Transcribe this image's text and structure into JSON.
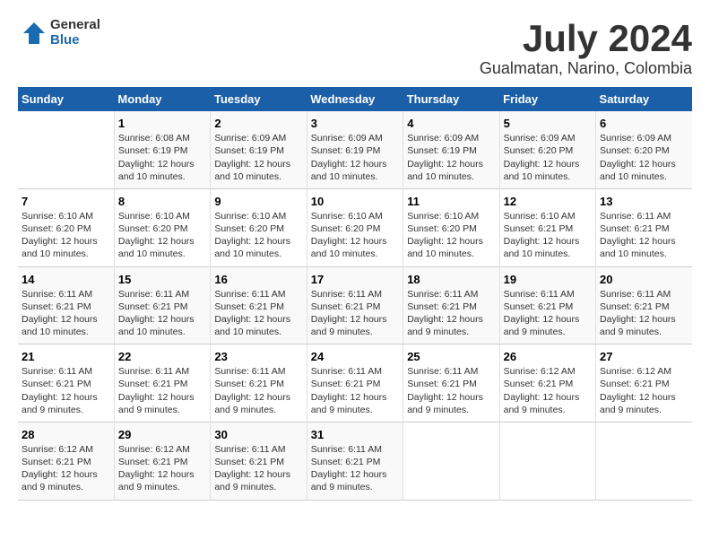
{
  "logo": {
    "text_general": "General",
    "text_blue": "Blue"
  },
  "header": {
    "title": "July 2024",
    "subtitle": "Gualmatan, Narino, Colombia"
  },
  "calendar": {
    "days_of_week": [
      "Sunday",
      "Monday",
      "Tuesday",
      "Wednesday",
      "Thursday",
      "Friday",
      "Saturday"
    ],
    "weeks": [
      [
        {
          "day": "",
          "info": ""
        },
        {
          "day": "1",
          "info": "Sunrise: 6:08 AM\nSunset: 6:19 PM\nDaylight: 12 hours and 10 minutes."
        },
        {
          "day": "2",
          "info": "Sunrise: 6:09 AM\nSunset: 6:19 PM\nDaylight: 12 hours and 10 minutes."
        },
        {
          "day": "3",
          "info": "Sunrise: 6:09 AM\nSunset: 6:19 PM\nDaylight: 12 hours and 10 minutes."
        },
        {
          "day": "4",
          "info": "Sunrise: 6:09 AM\nSunset: 6:19 PM\nDaylight: 12 hours and 10 minutes."
        },
        {
          "day": "5",
          "info": "Sunrise: 6:09 AM\nSunset: 6:20 PM\nDaylight: 12 hours and 10 minutes."
        },
        {
          "day": "6",
          "info": "Sunrise: 6:09 AM\nSunset: 6:20 PM\nDaylight: 12 hours and 10 minutes."
        }
      ],
      [
        {
          "day": "7",
          "info": "Sunrise: 6:10 AM\nSunset: 6:20 PM\nDaylight: 12 hours and 10 minutes."
        },
        {
          "day": "8",
          "info": "Sunrise: 6:10 AM\nSunset: 6:20 PM\nDaylight: 12 hours and 10 minutes."
        },
        {
          "day": "9",
          "info": "Sunrise: 6:10 AM\nSunset: 6:20 PM\nDaylight: 12 hours and 10 minutes."
        },
        {
          "day": "10",
          "info": "Sunrise: 6:10 AM\nSunset: 6:20 PM\nDaylight: 12 hours and 10 minutes."
        },
        {
          "day": "11",
          "info": "Sunrise: 6:10 AM\nSunset: 6:20 PM\nDaylight: 12 hours and 10 minutes."
        },
        {
          "day": "12",
          "info": "Sunrise: 6:10 AM\nSunset: 6:21 PM\nDaylight: 12 hours and 10 minutes."
        },
        {
          "day": "13",
          "info": "Sunrise: 6:11 AM\nSunset: 6:21 PM\nDaylight: 12 hours and 10 minutes."
        }
      ],
      [
        {
          "day": "14",
          "info": "Sunrise: 6:11 AM\nSunset: 6:21 PM\nDaylight: 12 hours and 10 minutes."
        },
        {
          "day": "15",
          "info": "Sunrise: 6:11 AM\nSunset: 6:21 PM\nDaylight: 12 hours and 10 minutes."
        },
        {
          "day": "16",
          "info": "Sunrise: 6:11 AM\nSunset: 6:21 PM\nDaylight: 12 hours and 10 minutes."
        },
        {
          "day": "17",
          "info": "Sunrise: 6:11 AM\nSunset: 6:21 PM\nDaylight: 12 hours and 9 minutes."
        },
        {
          "day": "18",
          "info": "Sunrise: 6:11 AM\nSunset: 6:21 PM\nDaylight: 12 hours and 9 minutes."
        },
        {
          "day": "19",
          "info": "Sunrise: 6:11 AM\nSunset: 6:21 PM\nDaylight: 12 hours and 9 minutes."
        },
        {
          "day": "20",
          "info": "Sunrise: 6:11 AM\nSunset: 6:21 PM\nDaylight: 12 hours and 9 minutes."
        }
      ],
      [
        {
          "day": "21",
          "info": "Sunrise: 6:11 AM\nSunset: 6:21 PM\nDaylight: 12 hours and 9 minutes."
        },
        {
          "day": "22",
          "info": "Sunrise: 6:11 AM\nSunset: 6:21 PM\nDaylight: 12 hours and 9 minutes."
        },
        {
          "day": "23",
          "info": "Sunrise: 6:11 AM\nSunset: 6:21 PM\nDaylight: 12 hours and 9 minutes."
        },
        {
          "day": "24",
          "info": "Sunrise: 6:11 AM\nSunset: 6:21 PM\nDaylight: 12 hours and 9 minutes."
        },
        {
          "day": "25",
          "info": "Sunrise: 6:11 AM\nSunset: 6:21 PM\nDaylight: 12 hours and 9 minutes."
        },
        {
          "day": "26",
          "info": "Sunrise: 6:12 AM\nSunset: 6:21 PM\nDaylight: 12 hours and 9 minutes."
        },
        {
          "day": "27",
          "info": "Sunrise: 6:12 AM\nSunset: 6:21 PM\nDaylight: 12 hours and 9 minutes."
        }
      ],
      [
        {
          "day": "28",
          "info": "Sunrise: 6:12 AM\nSunset: 6:21 PM\nDaylight: 12 hours and 9 minutes."
        },
        {
          "day": "29",
          "info": "Sunrise: 6:12 AM\nSunset: 6:21 PM\nDaylight: 12 hours and 9 minutes."
        },
        {
          "day": "30",
          "info": "Sunrise: 6:11 AM\nSunset: 6:21 PM\nDaylight: 12 hours and 9 minutes."
        },
        {
          "day": "31",
          "info": "Sunrise: 6:11 AM\nSunset: 6:21 PM\nDaylight: 12 hours and 9 minutes."
        },
        {
          "day": "",
          "info": ""
        },
        {
          "day": "",
          "info": ""
        },
        {
          "day": "",
          "info": ""
        }
      ]
    ]
  }
}
